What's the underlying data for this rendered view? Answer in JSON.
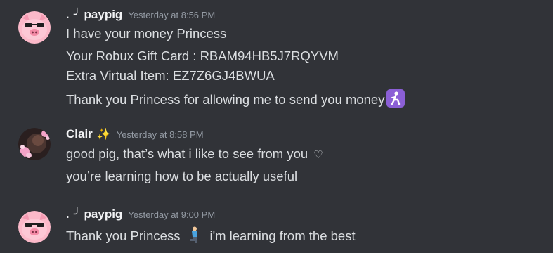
{
  "messages": [
    {
      "prefix": ". ╯",
      "username": "paypig",
      "timestamp": "Yesterday at 8:56 PM",
      "lines": [
        "I have your money Princess",
        "Your Robux Gift Card : RBAM94HB5J7RQYVM",
        "Extra Virtual Item: EZ7Z6GJ4BWUA",
        "Thank you Princess for allowing me to send you money"
      ],
      "emoji_icon": "kneeling-person-icon"
    },
    {
      "username": "Clair",
      "decoration_icon": "sparkles-icon",
      "timestamp": "Yesterday at 8:58 PM",
      "lines": [
        "good pig, that’s what i like to see from you",
        "you’re learning how to be actually useful"
      ],
      "heart_icon": "heart-outline-icon"
    },
    {
      "prefix": ". ╯",
      "username": "paypig",
      "timestamp": "Yesterday at 9:00 PM",
      "lines": [
        "Thank you Princess",
        "i'm learning from the best"
      ],
      "emoji_icon": "kneeling-man-icon"
    }
  ],
  "colors": {
    "background": "#313338",
    "text": "#dbdee1",
    "username": "#f2f3f5",
    "timestamp": "#949ba4",
    "emoji_purple": "#8b5fd6"
  }
}
